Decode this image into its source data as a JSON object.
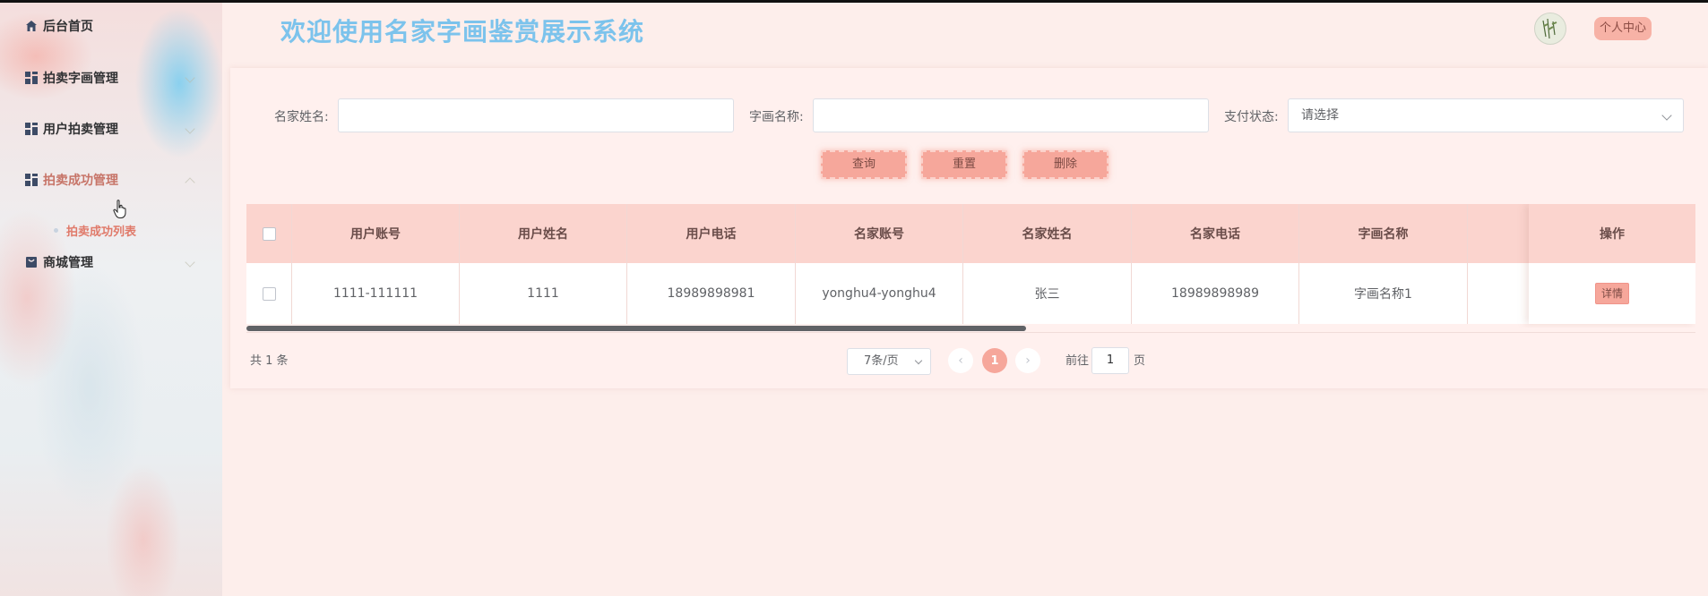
{
  "sidebar": {
    "items": [
      {
        "label": "后台首页",
        "icon": "home-icon"
      },
      {
        "label": "拍卖字画管理",
        "icon": "grid-icon"
      },
      {
        "label": "用户拍卖管理",
        "icon": "grid-icon"
      },
      {
        "label": "拍卖成功管理",
        "icon": "grid-icon"
      },
      {
        "label": "商城管理",
        "icon": "bag-icon"
      }
    ],
    "sub_item": "拍卖成功列表"
  },
  "header": {
    "title": "欢迎使用名家字画鉴赏展示系统",
    "user_center": "个人中心"
  },
  "filters": {
    "name_label": "名家姓名:",
    "name_value": "",
    "painting_label": "字画名称:",
    "painting_value": "",
    "pay_label": "支付状态:",
    "pay_placeholder": "请选择"
  },
  "actions": {
    "query": "查询",
    "reset": "重置",
    "delete": "删除"
  },
  "table": {
    "columns": [
      "用户账号",
      "用户姓名",
      "用户电话",
      "名家账号",
      "名家姓名",
      "名家电话",
      "字画名称"
    ],
    "ops_header": "操作",
    "rows": [
      {
        "cells": [
          "1111-111111",
          "1111",
          "18989898981",
          "yonghu4-yonghu4",
          "张三",
          "18989898989",
          "字画名称1"
        ],
        "detail": "详情"
      }
    ]
  },
  "pagination": {
    "total": "共 1 条",
    "page_size": "7条/页",
    "current_page": "1",
    "goto_label": "前往",
    "goto_value": "1",
    "goto_suffix": "页"
  },
  "colors": {
    "accent": "#f6a79b",
    "title": "#7cc3ec",
    "active_menu": "#c77468"
  }
}
